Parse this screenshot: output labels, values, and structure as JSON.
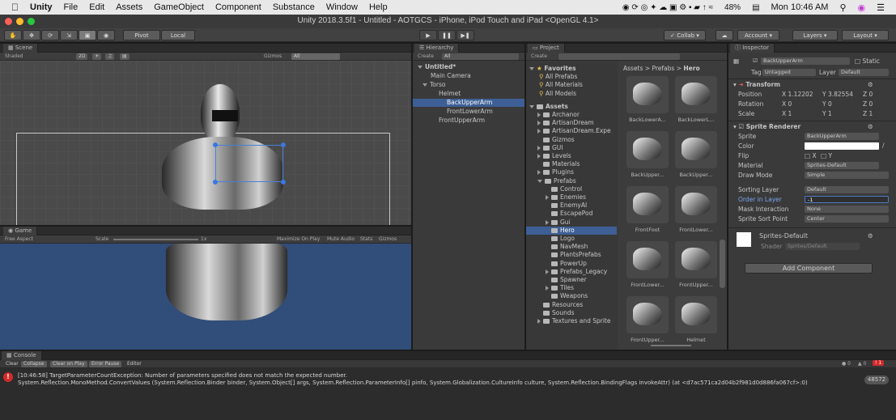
{
  "menubar": {
    "app": "Unity",
    "items": [
      "File",
      "Edit",
      "Assets",
      "GameObject",
      "Component",
      "Substance",
      "Window",
      "Help"
    ],
    "battery": "48%",
    "clock": "Mon 10:46 AM"
  },
  "window": {
    "title": "Unity 2018.3.5f1 - Untitled - AOTGCS - iPhone, iPod Touch and iPad <OpenGL 4.1>"
  },
  "toolbar": {
    "pivot": "Pivot",
    "local": "Local",
    "collab": "Collab",
    "account": "Account",
    "layers": "Layers",
    "layout": "Layout"
  },
  "scene": {
    "tab": "Scene",
    "shading": "Shaded",
    "mode2d": "2D",
    "gizmos": "Gizmos",
    "search": "All"
  },
  "game": {
    "tab": "Game",
    "aspect": "Free Aspect",
    "scale_label": "Scale",
    "scale_value": "1x",
    "options": [
      "Maximize On Play",
      "Mute Audio",
      "Stats",
      "Gizmos"
    ]
  },
  "hierarchy": {
    "tab": "Hierarchy",
    "create": "Create",
    "search": "All",
    "items": [
      "Untitled*",
      "Main Camera",
      "Torso",
      "Helmet",
      "BackUpperArm",
      "FrontLowerArm",
      "FrontUpperArm"
    ]
  },
  "project": {
    "tab": "Project",
    "create": "Create",
    "favorites": {
      "label": "Favorites",
      "items": [
        "All Prefabs",
        "All Materials",
        "All Models"
      ]
    },
    "assets_label": "Assets",
    "folders": [
      "Archanor",
      "ArtisanDream",
      "ArtisanDream.Expe",
      "Gizmos",
      "GUI",
      "Levels",
      "Materials",
      "Plugins",
      "Prefabs",
      "Control",
      "Enemies",
      "EnemyAI",
      "EscapePod",
      "Gui",
      "Hero",
      "Logo",
      "NavMesh",
      "PlantsPrefabs",
      "PowerUp",
      "Prefabs_Legacy",
      "Spawner",
      "Tiles",
      "Weapons",
      "Resources",
      "Sounds",
      "Textures and Sprite"
    ],
    "breadcrumb": [
      "Assets",
      "Prefabs",
      "Hero"
    ],
    "thumbnails": [
      "BackLowerA...",
      "BackLowerL...",
      "BackUpper...",
      "BackUpper...",
      "FrontFoot",
      "FrontLower...",
      "FrontLower...",
      "FrontUpper...",
      "FrontUpper...",
      "Helmet"
    ]
  },
  "inspector": {
    "tab": "Inspector",
    "object_name": "BackUpperArm",
    "static": "Static",
    "tag_label": "Tag",
    "tag_value": "Untagged",
    "layer_label": "Layer",
    "layer_value": "Default",
    "transform": {
      "title": "Transform",
      "position_label": "Position",
      "px": "1.12202",
      "py": "3.82554",
      "pz": "0",
      "rotation_label": "Rotation",
      "rx": "0",
      "ry": "0",
      "rz": "0",
      "scale_label": "Scale",
      "sx": "1",
      "sy": "1",
      "sz": "1"
    },
    "sprite_renderer": {
      "title": "Sprite Renderer",
      "sprite_label": "Sprite",
      "sprite_value": "BackUpperArm",
      "color_label": "Color",
      "flip_label": "Flip",
      "flip_x": "X",
      "flip_y": "Y",
      "material_label": "Material",
      "material_value": "Sprites-Default",
      "draw_mode_label": "Draw Mode",
      "draw_mode_value": "Simple",
      "sorting_layer_label": "Sorting Layer",
      "sorting_layer_value": "Default",
      "order_label": "Order in Layer",
      "order_value": "-1",
      "mask_label": "Mask Interaction",
      "mask_value": "None",
      "sort_point_label": "Sprite Sort Point",
      "sort_point_value": "Center"
    },
    "material": {
      "name": "Sprites-Default",
      "shader_label": "Shader",
      "shader_value": "Sprites/Default"
    },
    "add_component": "Add Component"
  },
  "console": {
    "tab": "Console",
    "buttons": [
      "Clear",
      "Collapse",
      "Clear on Play",
      "Error Pause",
      "Editor"
    ],
    "counts": [
      "0",
      "0",
      "1"
    ],
    "line1": "[10:46:58] TargetParameterCountException: Number of parameters specified does not match the expected number.",
    "line2": "System.Reflection.MonoMethod.ConvertValues (System.Reflection.Binder binder, System.Object[] args, System.Reflection.ParameterInfo[] pinfo, System.Globalization.CultureInfo culture, System.Reflection.BindingFlags invokeAttr) (at <d7ac571ca2d04b2f981d0d886fa067cf>:0)",
    "badge": "48572"
  },
  "colors": {
    "selection": "#3e5f96",
    "game_bg": "#314d79",
    "scene_bg": "#4a4a4a",
    "error": "#d12b2b"
  }
}
